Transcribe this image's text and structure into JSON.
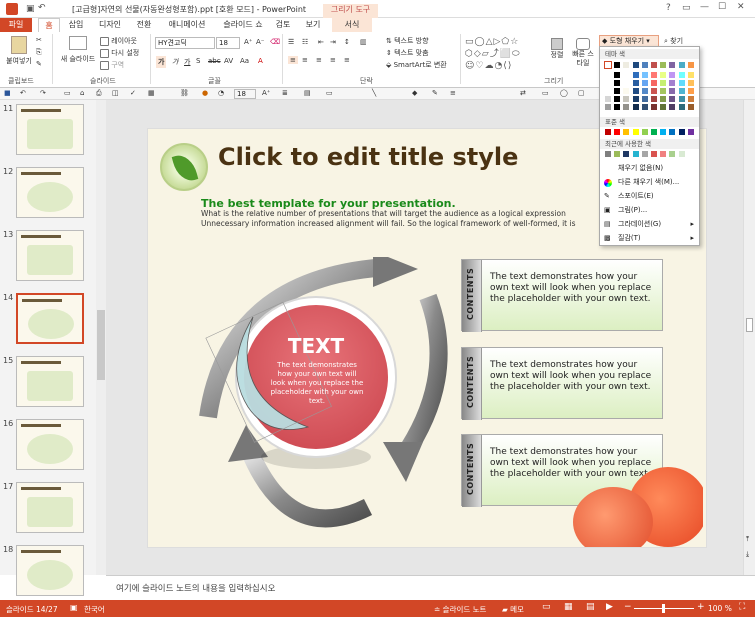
{
  "window": {
    "title": "[고급형]자연의 선물(자동완성형포함).ppt [호환 모드] - PowerPoint",
    "context_tab": "그리기 도구"
  },
  "tabs": {
    "file": "파일",
    "home": "홈",
    "insert": "삽입",
    "design": "디자인",
    "transitions": "전환",
    "animations": "애니메이션",
    "slideshow": "슬라이드 쇼",
    "review": "검토",
    "view": "보기",
    "format": "서식"
  },
  "ribbon": {
    "clipboard": {
      "paste": "붙여넣기",
      "label": "클립보드"
    },
    "slides": {
      "new_slide": "새 슬라이드",
      "layout": "레이아웃",
      "reset": "다시 설정",
      "section": "구역",
      "label": "슬라이드"
    },
    "font": {
      "name": "HY견고딕",
      "size": "18",
      "label": "글꼴"
    },
    "paragraph": {
      "text_direction": "텍스트 방향",
      "align_text": "텍스트 맞춤",
      "smartart": "SmartArt로 변환",
      "label": "단락"
    },
    "drawing": {
      "arrange": "정렬",
      "quick_styles": "빠른 스타일",
      "label": "그리기"
    },
    "shape_fill": "도형 채우기",
    "find": "찾기",
    "qat_size": "18"
  },
  "dropdown": {
    "theme_colors": "테마 색",
    "standard_colors": "표준 색",
    "recent_colors": "최근에 사용한 색",
    "no_fill": "채우기 없음(N)",
    "more_colors": "다른 채우기 색(M)...",
    "eyedropper": "스포이트(E)",
    "picture": "그림(P)...",
    "gradient": "그라데이션(G)",
    "texture": "질감(T)",
    "theme_top": [
      "#ffffff",
      "#000000",
      "#eeece1",
      "#1f497d",
      "#4f81bd",
      "#c0504d",
      "#9bbb59",
      "#8064a2",
      "#4bacc6",
      "#f79646"
    ],
    "standard": [
      "#c00000",
      "#ff0000",
      "#ffc000",
      "#ffff00",
      "#92d050",
      "#00b050",
      "#00b0f0",
      "#0070c0",
      "#002060",
      "#7030a0"
    ],
    "recent": [
      "#7f7f7f",
      "#9bbb59",
      "#1f3864",
      "#26b4d0",
      "#a6a6a6",
      "#d9534f",
      "#f08080",
      "#a9d08e",
      "#d9ead3"
    ]
  },
  "slides": [
    {
      "num": "11"
    },
    {
      "num": "12"
    },
    {
      "num": "13"
    },
    {
      "num": "14"
    },
    {
      "num": "15"
    },
    {
      "num": "16"
    },
    {
      "num": "17"
    },
    {
      "num": "18"
    }
  ],
  "slide": {
    "title": "Click to edit title style",
    "subtitle": "The best template for your presentation.",
    "body": "What is the relative number of presentations that will target the audience as a logical expression Unnecessary information increased alignment will fail. So the logical framework of well-formed, it is important to deploy.",
    "circle_title": "TEXT",
    "circle_text": "The text demonstrates how your own text will look when you replace the placeholder with your own text.",
    "boxes": [
      {
        "side": "CONTENTS",
        "text": "The text demonstrates how your own text will look when you replace the placeholder with your own text."
      },
      {
        "side": "CONTENTS",
        "text": "The text demonstrates how your own text will look when you replace the placeholder with your own text."
      },
      {
        "side": "CONTENTS",
        "text": "The text demonstrates how your own text will look when you replace the placeholder with your own text."
      }
    ]
  },
  "notes": {
    "placeholder": "여기에 슬라이드 노트의 내용을 입력하십시오"
  },
  "status": {
    "slide": "슬라이드 14/27",
    "language": "한국어",
    "notes": "슬라이드 노트",
    "comments": "메모",
    "zoom": "100 %"
  },
  "colors": {
    "accent": "#d24726",
    "selected_tab": "#fbe5d6"
  }
}
